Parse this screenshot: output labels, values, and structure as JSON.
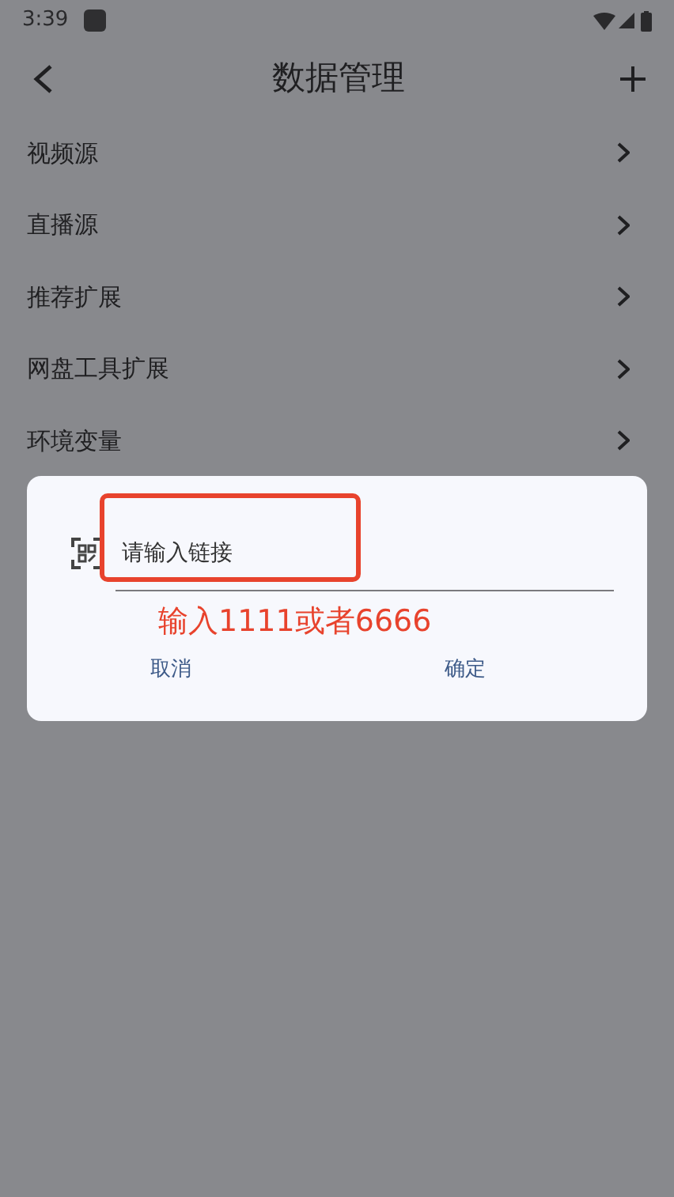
{
  "status_bar": {
    "time": "3:39"
  },
  "toolbar": {
    "title": "数据管理"
  },
  "items": [
    {
      "label": "视频源"
    },
    {
      "label": "直播源"
    },
    {
      "label": "推荐扩展"
    },
    {
      "label": "网盘工具扩展"
    },
    {
      "label": "环境变量"
    }
  ],
  "dialog": {
    "input": {
      "placeholder": "请输入链接"
    },
    "annotation": "输入1111或者6666",
    "buttons": [
      "取消",
      "确定"
    ]
  }
}
